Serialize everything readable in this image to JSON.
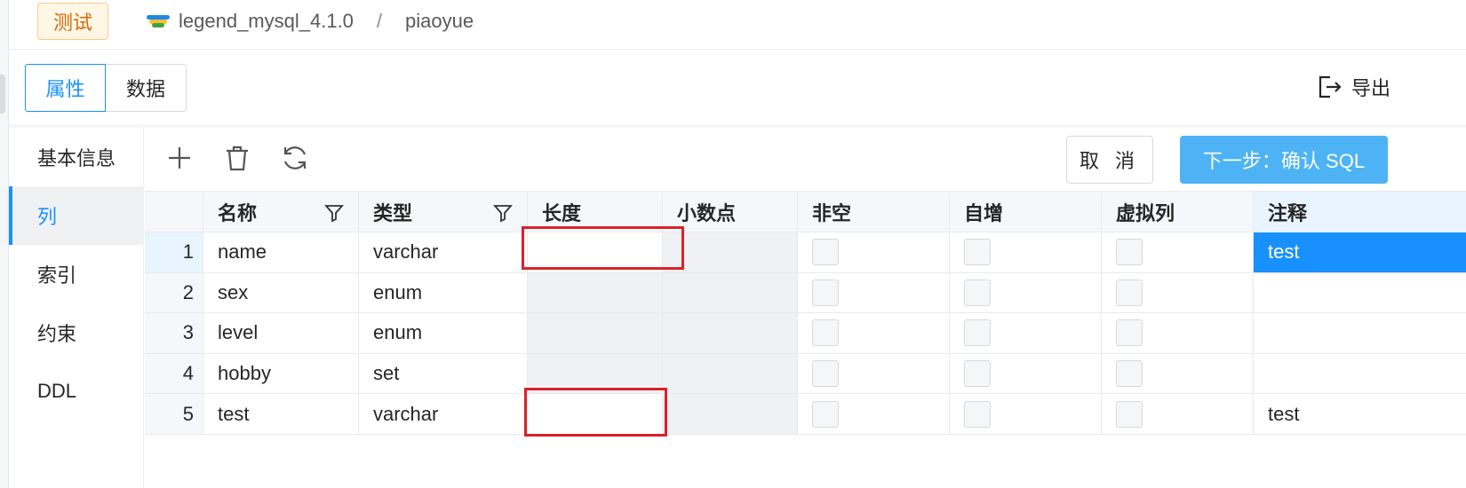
{
  "header": {
    "env_badge": "测试",
    "db_name": "legend_mysql_4.1.0",
    "separator": "/",
    "table_name": "piaoyue",
    "db_icon_colors": [
      "#1e88e5",
      "#fbc02d",
      "#43a047"
    ]
  },
  "tabs": [
    {
      "label": "属性",
      "active": true
    },
    {
      "label": "数据",
      "active": false
    }
  ],
  "export_label": "导出",
  "sidenav": [
    {
      "label": "基本信息",
      "active": false
    },
    {
      "label": "列",
      "active": true
    },
    {
      "label": "索引",
      "active": false
    },
    {
      "label": "约束",
      "active": false
    },
    {
      "label": "DDL",
      "active": false
    }
  ],
  "toolbar": {
    "add_icon": "plus-icon",
    "delete_icon": "trash-icon",
    "refresh_icon": "refresh-icon",
    "cancel_label": "取 消",
    "next_label": "下一步：确认 SQL"
  },
  "columns": [
    "名称",
    "类型",
    "长度",
    "小数点",
    "非空",
    "自增",
    "虚拟列",
    "注释"
  ],
  "rows": [
    {
      "index": "1",
      "name": "name",
      "type": "varchar",
      "length": "",
      "decimal": "",
      "not_null": false,
      "auto_inc": false,
      "virtual": false,
      "comment": "test"
    },
    {
      "index": "2",
      "name": "sex",
      "type": "enum",
      "length": "",
      "decimal": "",
      "not_null": false,
      "auto_inc": false,
      "virtual": false,
      "comment": ""
    },
    {
      "index": "3",
      "name": "level",
      "type": "enum",
      "length": "",
      "decimal": "",
      "not_null": false,
      "auto_inc": false,
      "virtual": false,
      "comment": ""
    },
    {
      "index": "4",
      "name": "hobby",
      "type": "set",
      "length": "",
      "decimal": "",
      "not_null": false,
      "auto_inc": false,
      "virtual": false,
      "comment": ""
    },
    {
      "index": "5",
      "name": "test",
      "type": "varchar",
      "length": "",
      "decimal": "",
      "not_null": false,
      "auto_inc": false,
      "virtual": false,
      "comment": "test"
    }
  ],
  "colors": {
    "accent": "#1890ff",
    "primary_button": "#4db3f5",
    "annotation_red": "#d9222a",
    "env_badge_text": "#d46b08"
  }
}
